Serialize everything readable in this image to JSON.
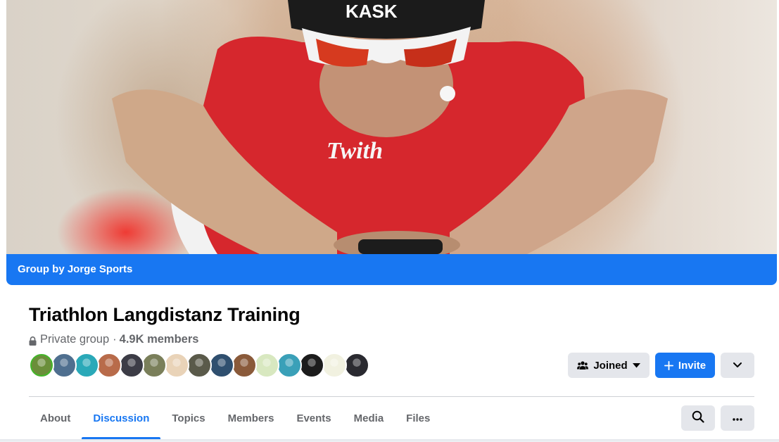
{
  "cover": {
    "banner_text": "Group by Jorge Sports",
    "helmet_brand": "KASK",
    "jersey_text": "Twith"
  },
  "group": {
    "name": "Triathlon Langdistanz Training",
    "privacy": "Private group",
    "separator": "·",
    "members": "4.9K members"
  },
  "member_avatars": [
    {
      "color": "#6b8e3a"
    },
    {
      "color": "#4f6f8f"
    },
    {
      "color": "#2aa9b8"
    },
    {
      "color": "#b86b4a"
    },
    {
      "color": "#3c3c46"
    },
    {
      "color": "#7a7f5a"
    },
    {
      "color": "#e9d3b8"
    },
    {
      "color": "#5a5a4a"
    },
    {
      "color": "#2f4f6f"
    },
    {
      "color": "#8a5a3a"
    },
    {
      "color": "#d8e8c0"
    },
    {
      "color": "#3aa0b8"
    },
    {
      "color": "#1c1c1c"
    },
    {
      "color": "#f1f1e0"
    },
    {
      "color": "#2a2a30"
    }
  ],
  "actions": {
    "joined_label": "Joined",
    "invite_label": "Invite"
  },
  "tabs": [
    {
      "label": "About",
      "active": false
    },
    {
      "label": "Discussion",
      "active": true
    },
    {
      "label": "Topics",
      "active": false
    },
    {
      "label": "Members",
      "active": false
    },
    {
      "label": "Events",
      "active": false
    },
    {
      "label": "Media",
      "active": false
    },
    {
      "label": "Files",
      "active": false
    }
  ],
  "colors": {
    "accent": "#1877f2",
    "button_gray": "#e4e6eb",
    "secondary_text": "#65676b"
  },
  "icons": {
    "lock": "lock-icon",
    "joined": "people-icon",
    "invite": "plus-icon",
    "more": "chevron-down-icon",
    "search": "search-icon",
    "overflow": "ellipsis-icon"
  }
}
